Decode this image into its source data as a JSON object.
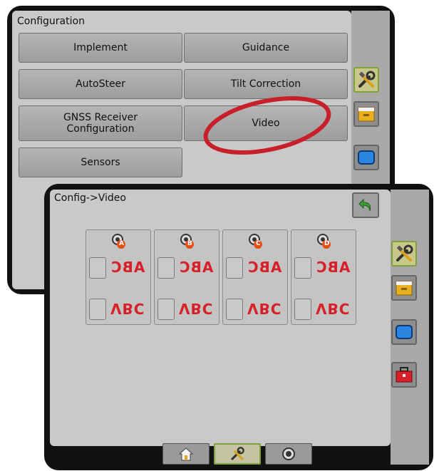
{
  "back_panel": {
    "title": "Configuration",
    "buttons": {
      "implement": "Implement",
      "guidance": "Guidance",
      "autosteer": "AutoSteer",
      "tilt_correction": "Tilt Correction",
      "gnss_receiver": "GNSS Receiver Configuration",
      "video": "Video",
      "sensors": "Sensors"
    },
    "side_icons": [
      "tools-icon",
      "file-cabinet-icon",
      "monitor-icon"
    ]
  },
  "front_panel": {
    "title": "Config->Video",
    "cameras": [
      {
        "label": "A",
        "row1_text": "ABC",
        "row2_text": "VBC"
      },
      {
        "label": "B",
        "row1_text": "ABC",
        "row2_text": "VBC"
      },
      {
        "label": "C",
        "row1_text": "ABC",
        "row2_text": "VBC"
      },
      {
        "label": "D",
        "row1_text": "ABC",
        "row2_text": "VBC"
      }
    ],
    "side_icons": [
      "tools-icon",
      "file-cabinet-icon",
      "monitor-icon",
      "toolbox-icon"
    ],
    "tabs": [
      "home-icon",
      "tools-icon",
      "camera-icon"
    ]
  },
  "colors": {
    "highlight_circle": "#c8202a",
    "active_green": "#7fa03a",
    "abc_red": "#d8202a"
  }
}
